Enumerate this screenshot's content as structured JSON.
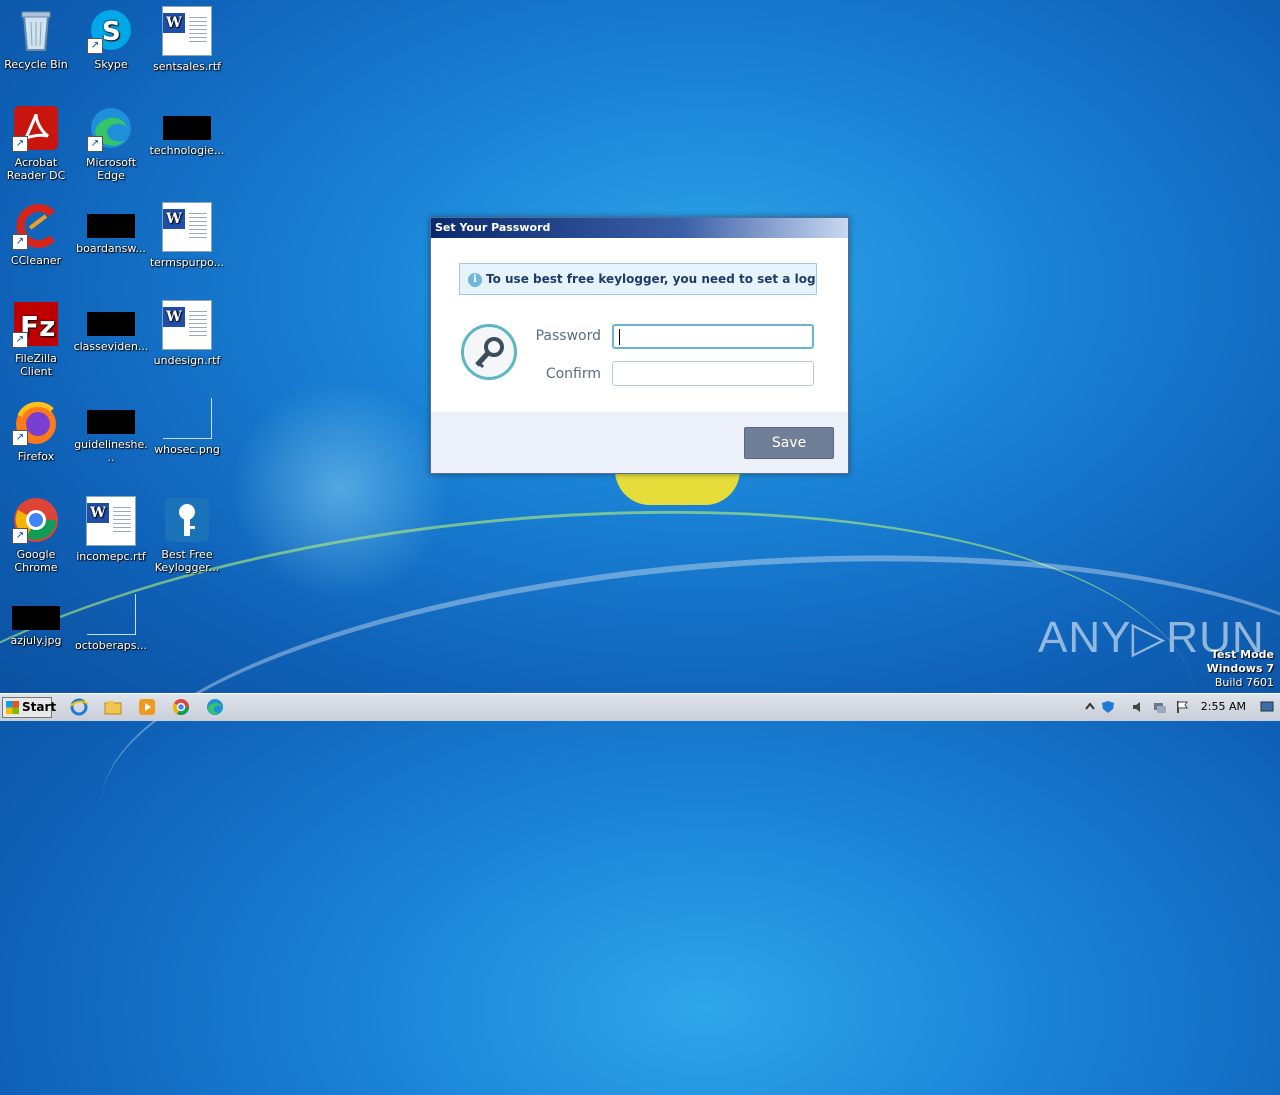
{
  "desktop": {
    "icons": [
      {
        "label": "Recycle Bin"
      },
      {
        "label": "Skype"
      },
      {
        "label": "sentsales.rtf"
      },
      {
        "label": "Acrobat Reader DC"
      },
      {
        "label": "Microsoft Edge"
      },
      {
        "label": "technologie..."
      },
      {
        "label": "CCleaner"
      },
      {
        "label": "boardansw..."
      },
      {
        "label": "termspurpo..."
      },
      {
        "label": "FileZilla Client"
      },
      {
        "label": "classeviden..."
      },
      {
        "label": "undesign.rtf"
      },
      {
        "label": "Firefox"
      },
      {
        "label": "guidelineshe..."
      },
      {
        "label": "whosec.png"
      },
      {
        "label": "Google Chrome"
      },
      {
        "label": "incomepc.rtf"
      },
      {
        "label": "Best Free Keylogger..."
      },
      {
        "label": "azjuly.jpg"
      },
      {
        "label": "octoberaps..."
      }
    ]
  },
  "dialog": {
    "title": "Set Your Password",
    "info_text": "To use best free keylogger, you need to set a login p",
    "password_label": "Password",
    "password_value": "",
    "confirm_label": "Confirm",
    "confirm_value": "",
    "save_label": "Save"
  },
  "watermark": {
    "brand": "ANY▷RUN",
    "line1": "Test Mode",
    "line2": "Windows 7",
    "line3": "Build 7601"
  },
  "taskbar": {
    "start_label": "Start",
    "clock": "2:55 AM"
  }
}
